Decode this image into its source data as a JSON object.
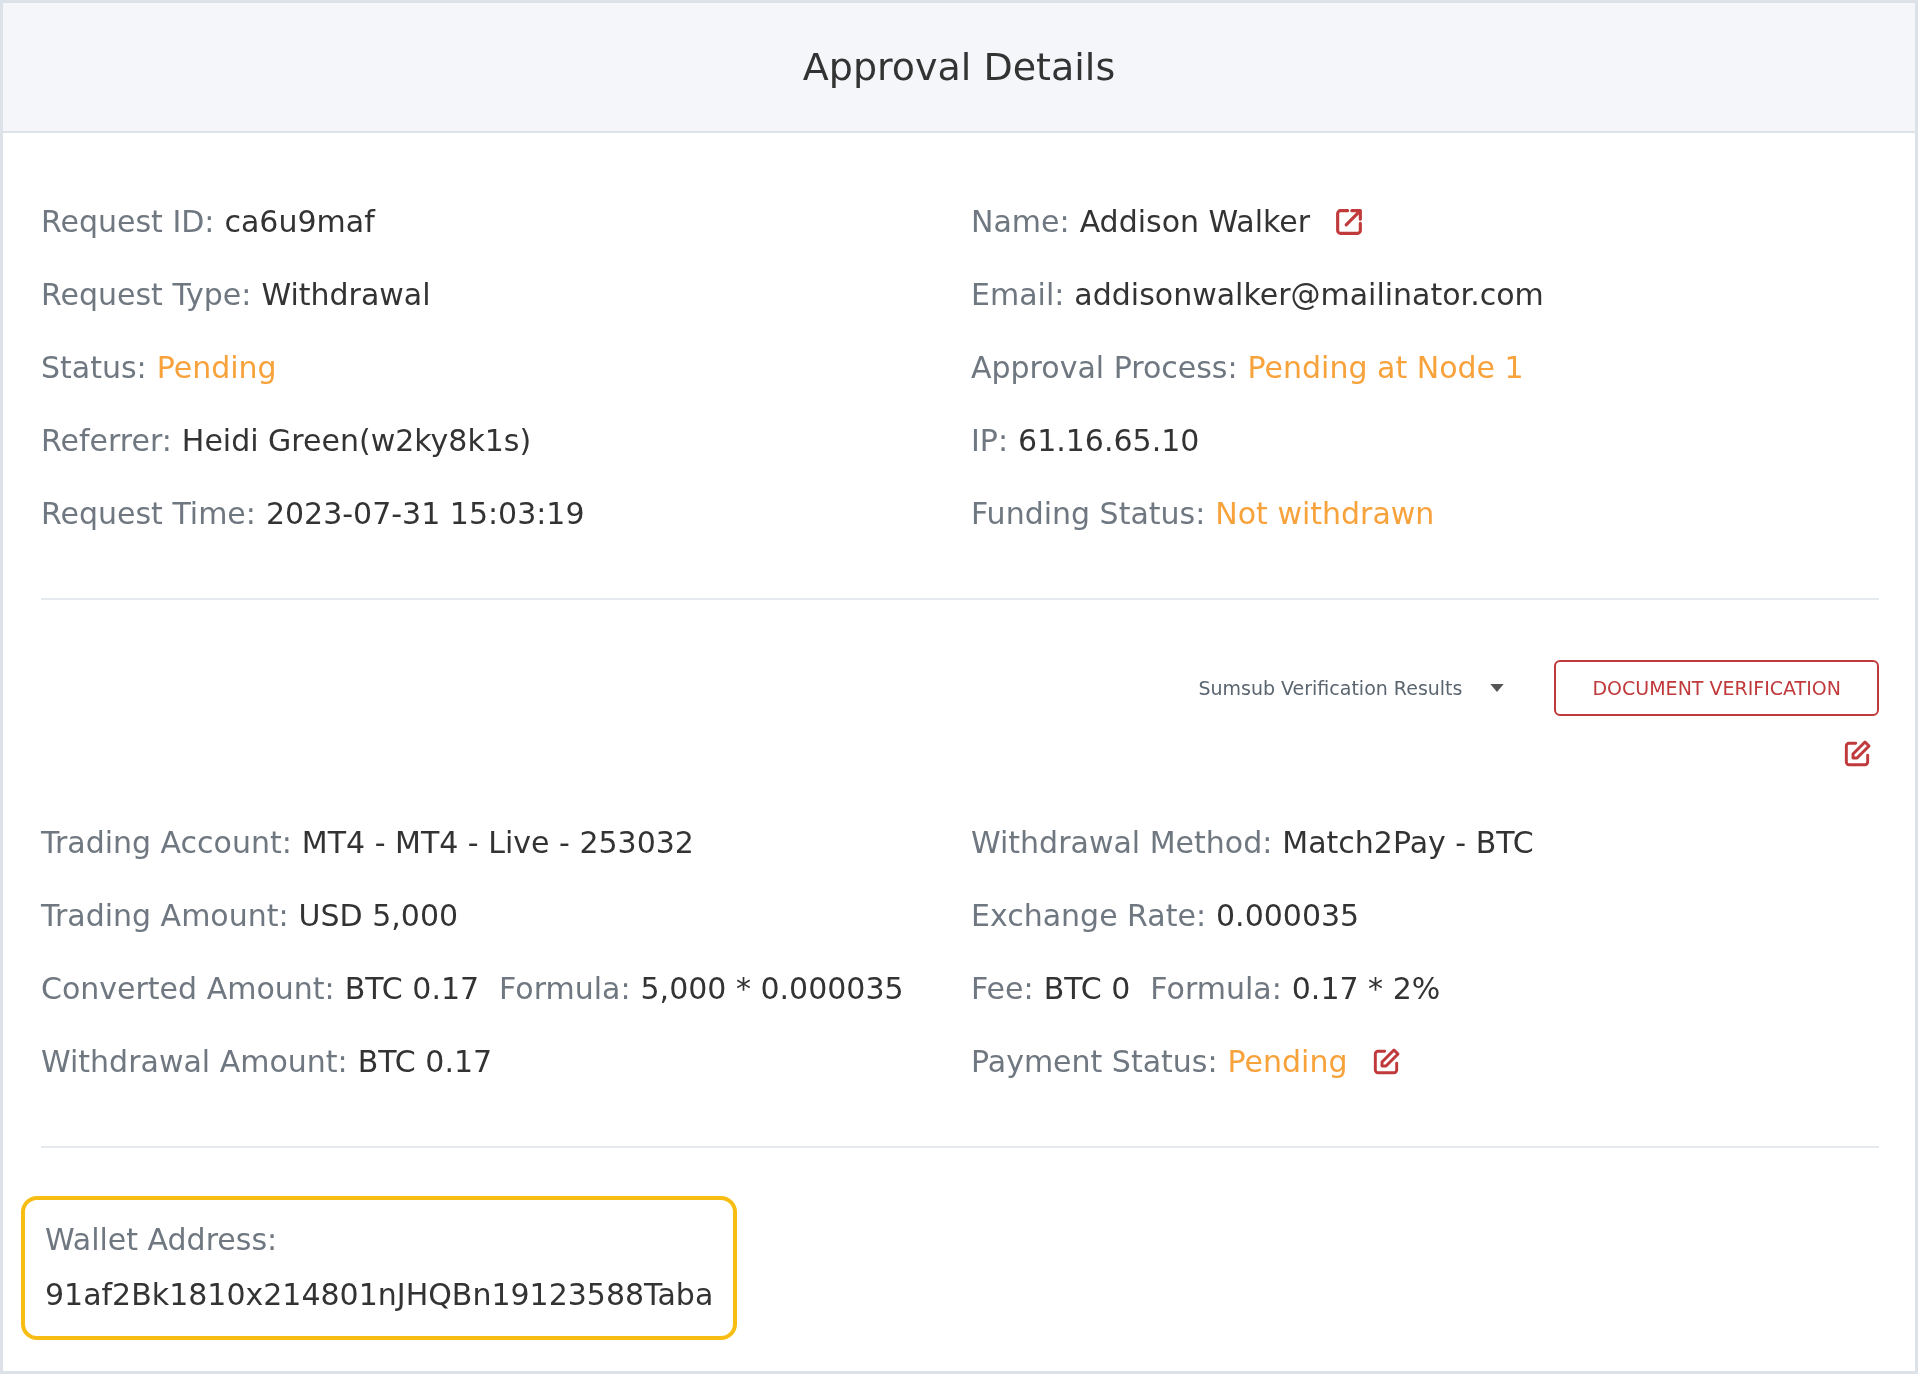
{
  "title": "Approval Details",
  "summary": [
    {
      "label": "Request ID:",
      "value": "ca6u9maf",
      "kind": "text"
    },
    {
      "label": "Name:",
      "value": "Addison Walker",
      "kind": "profile-link"
    },
    {
      "label": "Request Type:",
      "value": "Withdrawal",
      "kind": "text"
    },
    {
      "label": "Email:",
      "value": "addisonwalker@mailinator.com",
      "kind": "text"
    },
    {
      "label": "Status:",
      "value": "Pending",
      "kind": "status"
    },
    {
      "label": "Approval Process:",
      "value": "Pending at Node 1",
      "kind": "status"
    },
    {
      "label": "Referrer:",
      "value": "Heidi Green(w2ky8k1s)",
      "kind": "text"
    },
    {
      "label": "IP:",
      "value": "61.16.65.10",
      "kind": "text"
    },
    {
      "label": "Request Time:",
      "value": "2023-07-31 15:03:19",
      "kind": "text"
    },
    {
      "label": "Funding Status:",
      "value": "Not withdrawn",
      "kind": "status"
    }
  ],
  "verification": {
    "dropdown": "Sumsub Verification Results",
    "button": "DOCUMENT VERIFICATION"
  },
  "details": [
    {
      "label": "Trading Account:",
      "value": "MT4 - MT4 - Live - 253032",
      "kind": "text"
    },
    {
      "label": "Withdrawal Method:",
      "value": "Match2Pay - BTC",
      "kind": "text"
    },
    {
      "label": "Trading Amount:",
      "value": "USD 5,000",
      "kind": "text"
    },
    {
      "label": "Exchange Rate:",
      "value": "0.000035",
      "kind": "text"
    },
    {
      "label": "Converted Amount:",
      "value": "BTC 0.17",
      "kind": "text",
      "formula_label": "Formula:",
      "formula": "5,000 * 0.000035"
    },
    {
      "label": "Fee:",
      "value": "BTC 0",
      "kind": "text",
      "formula_label": "Formula:",
      "formula": "0.17 * 2%"
    },
    {
      "label": "Withdrawal Amount:",
      "value": "BTC 0.17",
      "kind": "text"
    },
    {
      "label": "Payment Status:",
      "value": "Pending",
      "kind": "editable-status"
    }
  ],
  "wallet": {
    "label": "Wallet Address:",
    "value": "91af2Bk1810x214801nJHQBn19123588Taba",
    "highlighted": true
  }
}
